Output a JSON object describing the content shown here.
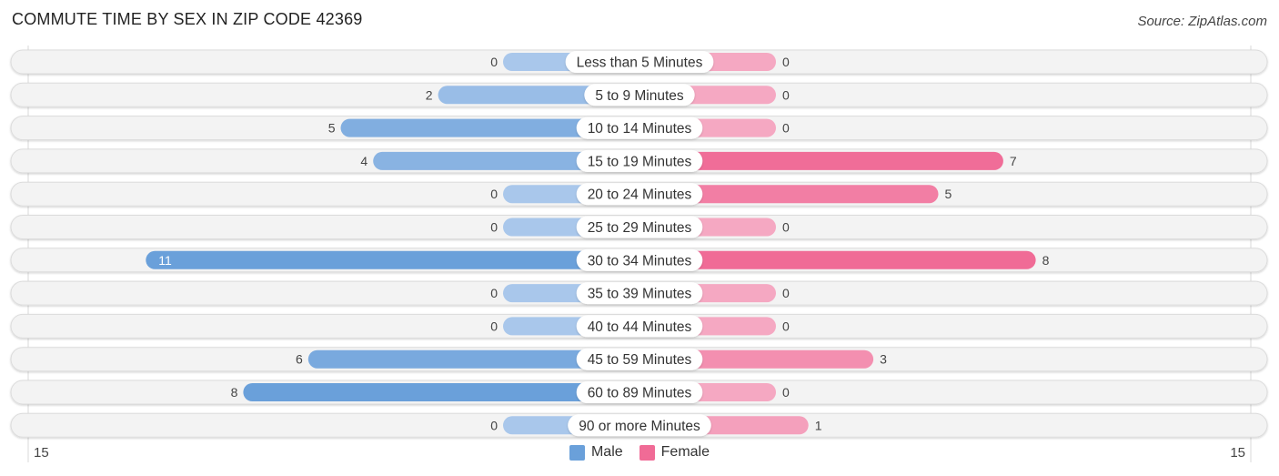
{
  "header": {
    "title": "COMMUTE TIME BY SEX IN ZIP CODE 42369",
    "source": "Source: ZipAtlas.com"
  },
  "colors": {
    "male": "#6aa0da",
    "male_light": "#a9c7eb",
    "female": "#f06b96",
    "female_light": "#f5a8c2",
    "row_bg": "#f3f3f3"
  },
  "chart_data": {
    "type": "bar",
    "orientation": "horizontal-diverging",
    "title": "COMMUTE TIME BY SEX IN ZIP CODE 42369",
    "categories": [
      "Less than 5 Minutes",
      "5 to 9 Minutes",
      "10 to 14 Minutes",
      "15 to 19 Minutes",
      "20 to 24 Minutes",
      "25 to 29 Minutes",
      "30 to 34 Minutes",
      "35 to 39 Minutes",
      "40 to 44 Minutes",
      "45 to 59 Minutes",
      "60 to 89 Minutes",
      "90 or more Minutes"
    ],
    "series": [
      {
        "name": "Male",
        "values": [
          0,
          2,
          5,
          4,
          0,
          0,
          11,
          0,
          0,
          6,
          8,
          0
        ]
      },
      {
        "name": "Female",
        "values": [
          0,
          0,
          0,
          7,
          5,
          0,
          8,
          0,
          0,
          3,
          0,
          1
        ]
      }
    ],
    "axis": {
      "left_label": "15",
      "right_label": "15",
      "range": [
        -15,
        15
      ]
    },
    "legend": {
      "position": "bottom-center",
      "entries": [
        "Male",
        "Female"
      ]
    }
  }
}
